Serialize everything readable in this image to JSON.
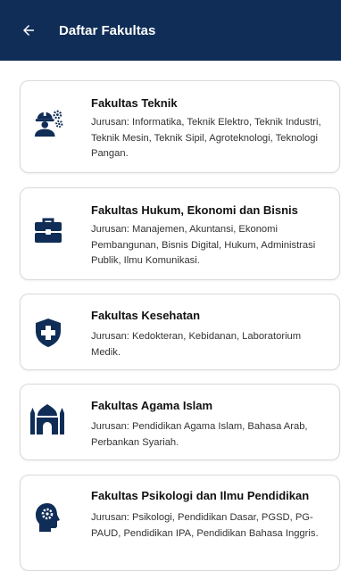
{
  "header": {
    "back_icon": "arrow-left-icon",
    "title": "Daftar Fakultas"
  },
  "faculties": [
    {
      "icon": "engineer-gear-icon",
      "name": "Fakultas Teknik",
      "desc": "Jurusan: Informatika, Teknik Elektro, Teknik Industri, Teknik Mesin, Teknik Sipil, Agroteknologi, Teknologi Pangan."
    },
    {
      "icon": "briefcase-icon",
      "name": "Fakultas Hukum, Ekonomi dan Bisnis",
      "desc": "Jurusan: Manajemen, Akuntansi, Ekonomi Pembangunan, Bisnis Digital, Hukum, Administrasi Publik, Ilmu Komunikasi."
    },
    {
      "icon": "medical-shield-icon",
      "name": "Fakultas Kesehatan",
      "desc": "Jurusan: Kedokteran, Kebidanan, Laboratorium Medik."
    },
    {
      "icon": "mosque-icon",
      "name": "Fakultas Agama Islam",
      "desc": "Jurusan: Pendidikan Agama Islam, Bahasa Arab, Perbankan Syariah."
    },
    {
      "icon": "head-gear-icon",
      "name": "Fakultas Psikologi dan Ilmu Pendidikan",
      "desc": "Jurusan: Psikologi, Pendidikan Dasar, PGSD, PG-PAUD, Pendidikan IPA, Pendidikan Bahasa Inggris."
    }
  ],
  "colors": {
    "appbar": "#0f2d57",
    "icon": "#0f2d57",
    "card_border": "#d9d9d9"
  }
}
